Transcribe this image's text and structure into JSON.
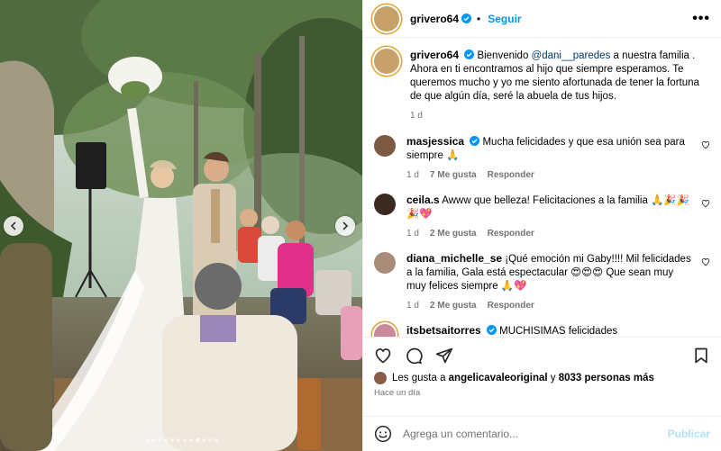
{
  "post": {
    "author": "grivero64",
    "follow_label": "Seguir",
    "more_label": "•••"
  },
  "caption": {
    "author": "grivero64",
    "text_before": "Bienvenido ",
    "mention": "@dani__paredes",
    "text_after": " a nuestra familia . Ahora en ti encontramos al hijo que siempre esperamos. Te queremos mucho y yo me siento afortunada de tener la fortuna de que algún día, seré la abuela de tus hijos.",
    "time": "1 d"
  },
  "comments": [
    {
      "user": "masjessica",
      "verified": true,
      "text": "Mucha felicidades y que esa unión sea para siempre 🙏",
      "time": "1 d",
      "likes": "7 Me gusta",
      "reply": "Responder"
    },
    {
      "user": "ceila.s",
      "verified": false,
      "text": "Awww que belleza! Felicitaciones a la familia 🙏🎉🎉🎉💖",
      "time": "1 d",
      "likes": "2 Me gusta",
      "reply": "Responder"
    },
    {
      "user": "diana_michelle_se",
      "verified": false,
      "text": "¡Qué emoción mi Gaby!!!! Mil felicidades a la familia, Gala está espectacular 😍😍😍 Que sean muy muy felices siempre 🙏💖",
      "time": "1 d",
      "likes": "2 Me gusta",
      "reply": "Responder"
    },
    {
      "user": "itsbetsaitorres",
      "verified": true,
      "text": "MUCHISIMAS felicidades ",
      "time": "",
      "likes": "",
      "reply": ""
    }
  ],
  "likes": {
    "prefix": "Les gusta a ",
    "user": "angelicavaleoriginal",
    "middle": " y ",
    "others": "8033 personas más"
  },
  "time_ago": "Hace un día",
  "composer": {
    "placeholder": "Agrega un comentario...",
    "post_label": "Publicar"
  },
  "colors": {
    "accent": "#0095f6",
    "verified": "#0095f6",
    "post_disabled": "#b2dffc"
  },
  "icons": [
    "chevron-left-icon",
    "chevron-right-icon",
    "heart-icon",
    "comment-icon",
    "share-icon",
    "bookmark-icon",
    "emoji-icon",
    "verified-icon",
    "more-icon"
  ],
  "carousel": {
    "total": 12,
    "active": 9
  }
}
